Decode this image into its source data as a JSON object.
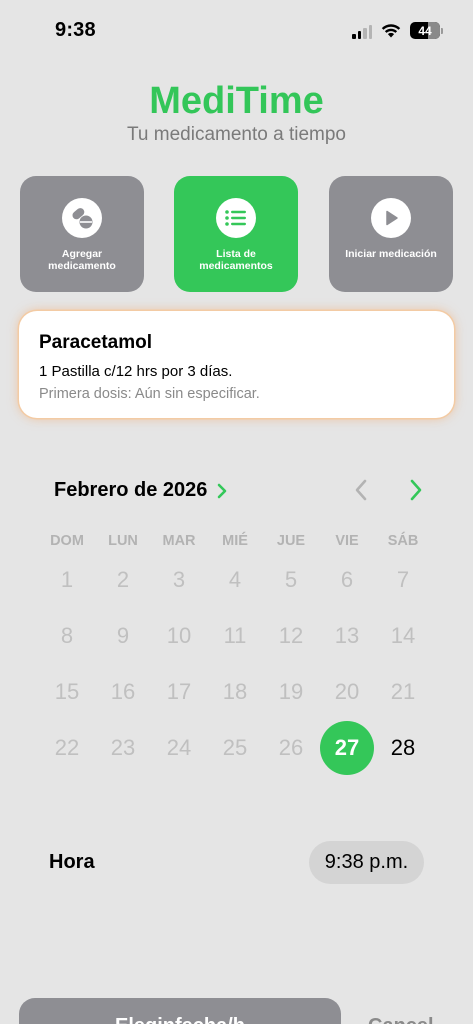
{
  "status": {
    "time": "9:38",
    "battery": "44"
  },
  "header": {
    "title": "MediTime",
    "subtitle": "Tu medicamento a tiempo"
  },
  "actions": [
    {
      "label": "Agregar medicamento",
      "icon": "pills-icon",
      "active": false
    },
    {
      "label": "Lista de medicamentos",
      "icon": "list-icon",
      "active": true
    },
    {
      "label": "Iniciar medicación",
      "icon": "play-icon",
      "active": false
    }
  ],
  "medication": {
    "name": "Paracetamol",
    "dose": "1 Pastilla c/12 hrs por 3 días.",
    "first_dose": "Primera dosis: Aún sin especificar."
  },
  "calendar": {
    "month": "Febrero de 2026",
    "weekdays": [
      "DOM",
      "LUN",
      "MAR",
      "MIÉ",
      "JUE",
      "VIE",
      "SÁB"
    ],
    "days": [
      "1",
      "2",
      "3",
      "4",
      "5",
      "6",
      "7",
      "8",
      "9",
      "10",
      "11",
      "12",
      "13",
      "14",
      "15",
      "16",
      "17",
      "18",
      "19",
      "20",
      "21",
      "22",
      "23",
      "24",
      "25",
      "26",
      "27",
      "28"
    ],
    "selected_day": "27",
    "available_days": [
      "27",
      "28"
    ]
  },
  "time": {
    "label": "Hora",
    "value": "9:38 p.m."
  },
  "footer": {
    "primary_label": "Eleginfecha/h",
    "secondary_label": "Cancel"
  },
  "colors": {
    "accent": "#34c759",
    "tile_inactive": "#8e8e93",
    "card_glow": "#f4aa6e"
  }
}
